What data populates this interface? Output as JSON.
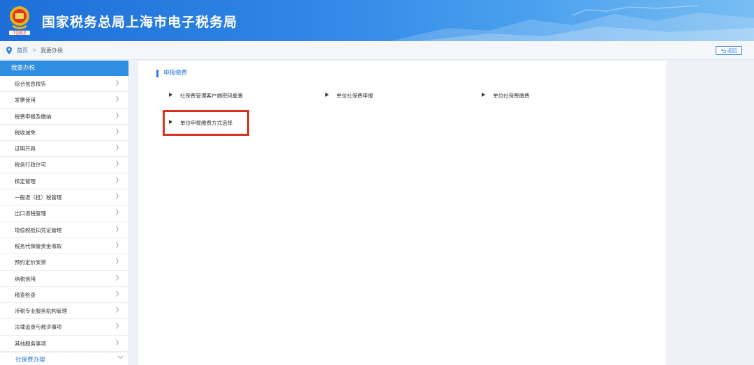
{
  "header": {
    "title": "国家税务总局上海市电子税务局",
    "logo_icon": "tax-emblem-icon"
  },
  "breadcrumb": {
    "home": "首页",
    "separator": ">",
    "current": "我要办税",
    "back_label": "返回"
  },
  "sidebar": {
    "heading": "我要办税",
    "items": [
      "综合信息报告",
      "发票使用",
      "税费申报及缴纳",
      "税收减免",
      "证明开具",
      "税务行政许可",
      "核定管理",
      "一般退（抵）税管理",
      "出口退税管理",
      "增值税抵扣凭证管理",
      "税务代保管资金收取",
      "预约定价安排",
      "纳税信用",
      "稽查检查",
      "涉税专业服务机构管理",
      "法律追责与救济事项",
      "其他服务事项"
    ],
    "footer": "社保费办理"
  },
  "main": {
    "section_title": "申报缴费",
    "links": [
      "社保费管理客户端密码重置",
      "单位社保费申报",
      "单位社保费缴费",
      "单位申报缴费方式选择"
    ]
  },
  "colors": {
    "header_blue": "#2f86e6",
    "accent": "#2d7ddc",
    "highlight": "#d6331f"
  }
}
